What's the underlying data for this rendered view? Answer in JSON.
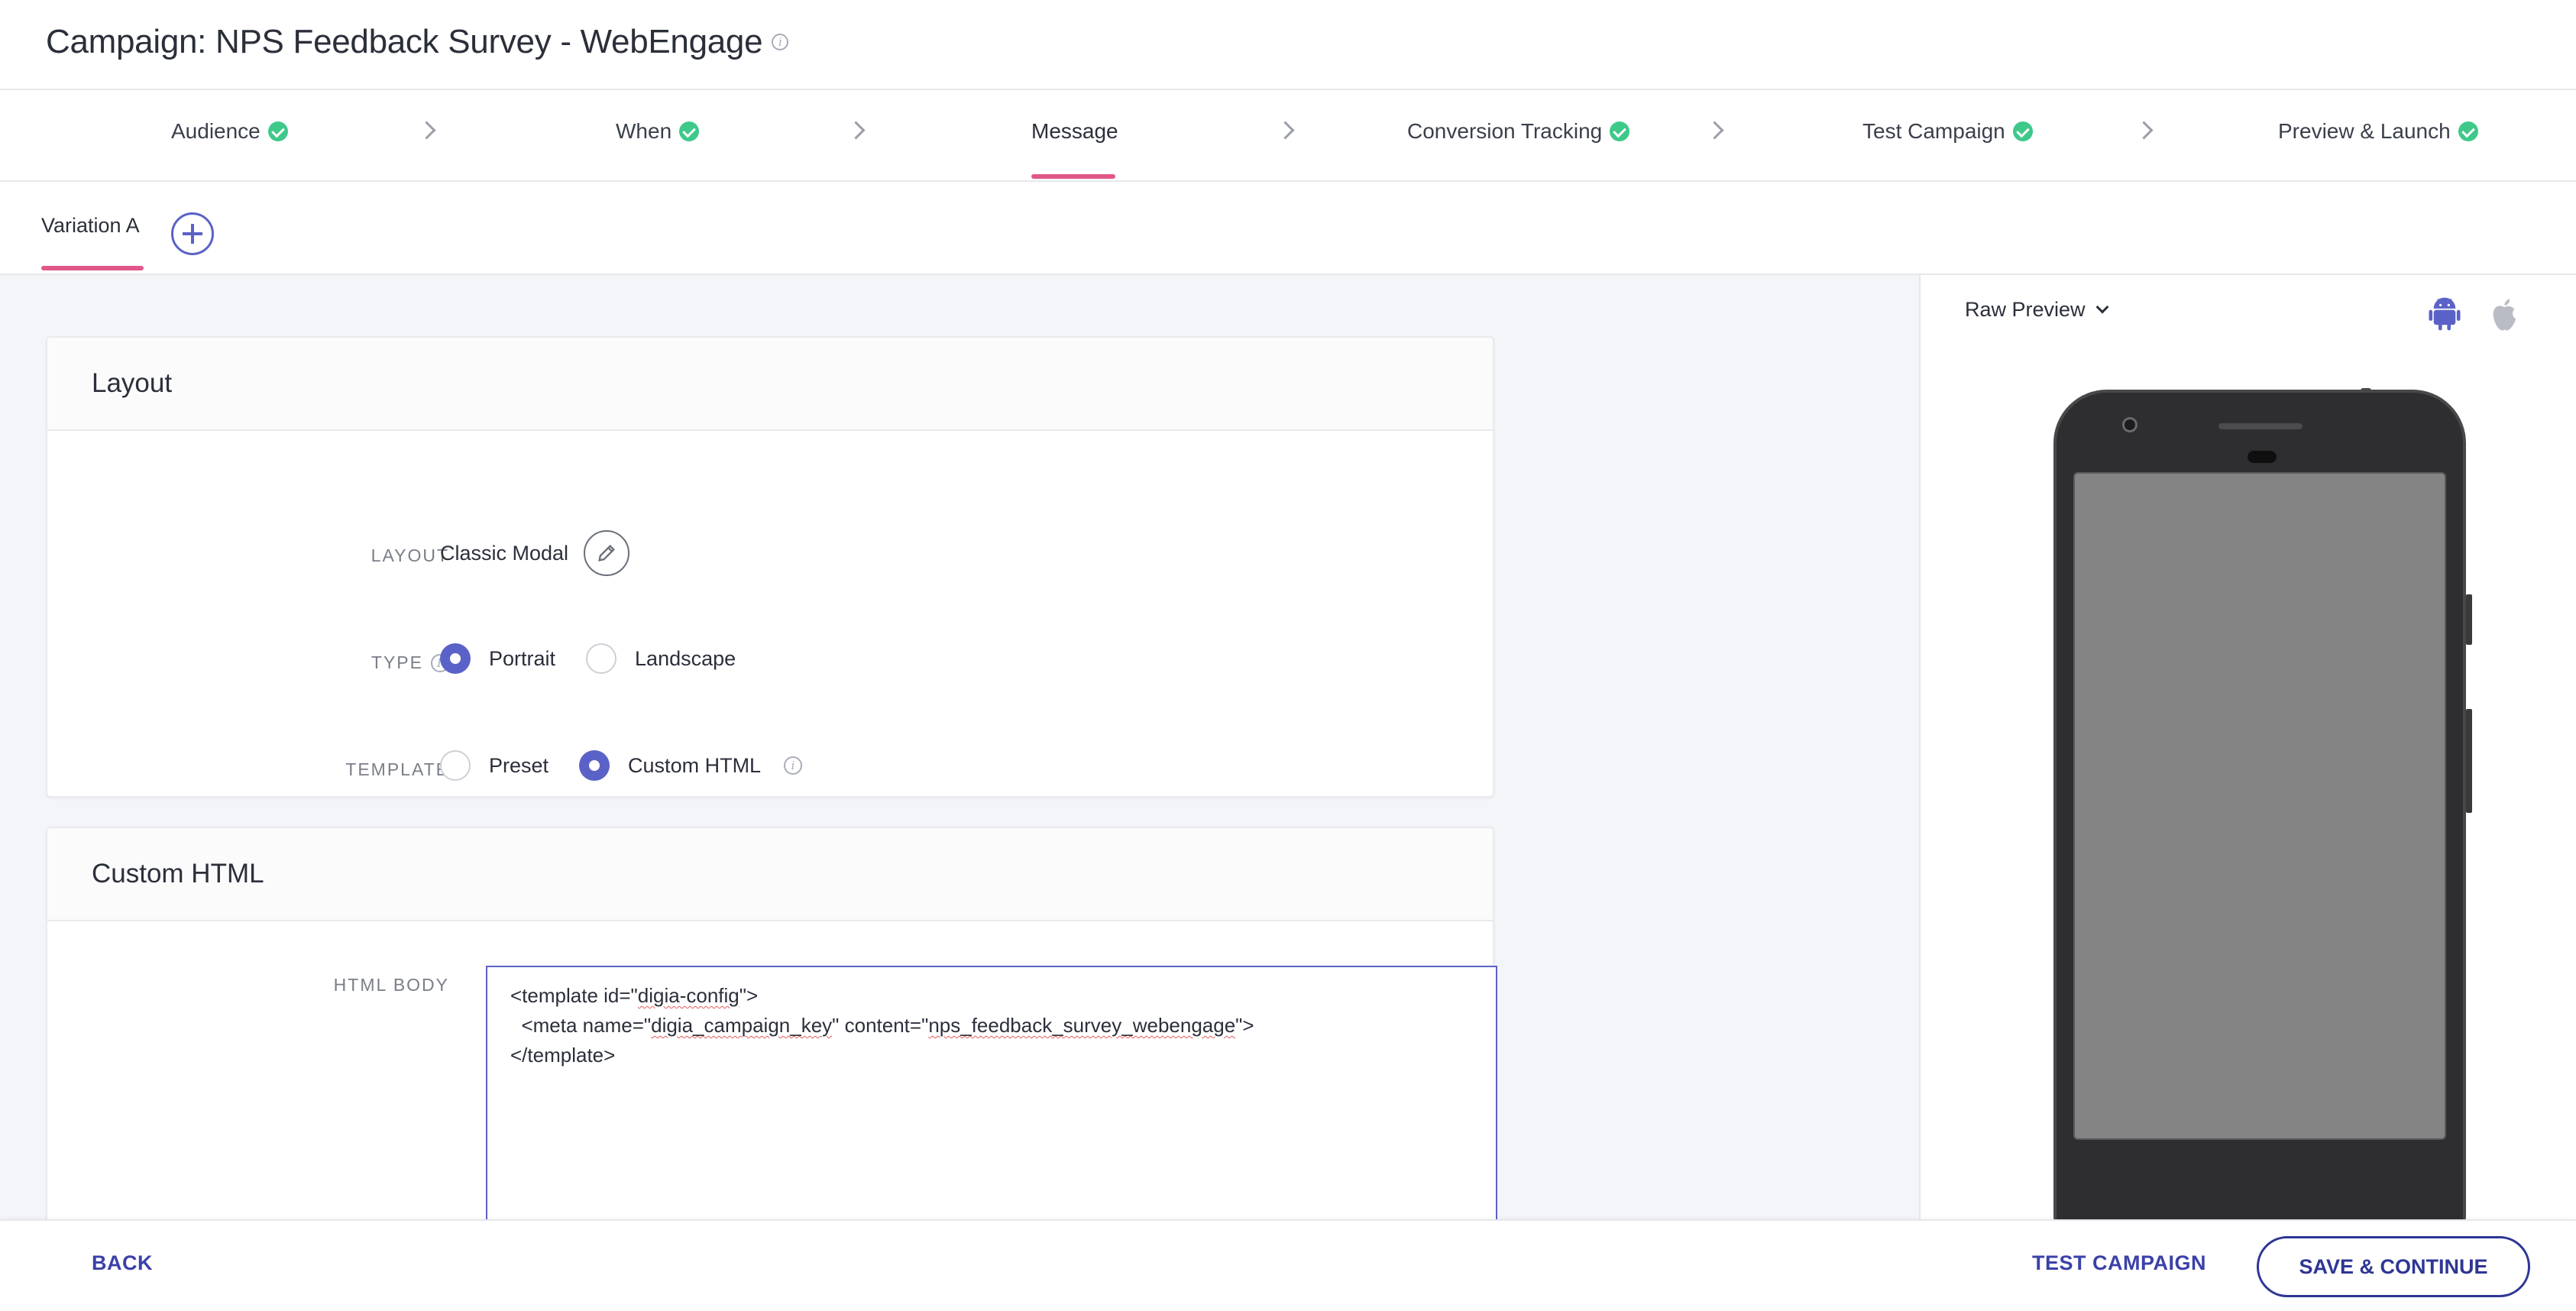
{
  "header": {
    "title": "Campaign: NPS Feedback Survey - WebEngage"
  },
  "steps": [
    {
      "label": "Audience",
      "done": true
    },
    {
      "label": "When",
      "done": true
    },
    {
      "label": "Message",
      "done": false,
      "active": true
    },
    {
      "label": "Conversion Tracking",
      "done": true
    },
    {
      "label": "Test Campaign",
      "done": true
    },
    {
      "label": "Preview & Launch",
      "done": true
    }
  ],
  "variations": {
    "active_tab": "Variation A"
  },
  "layout_card": {
    "title": "Layout",
    "layout_label": "LAYOUT",
    "layout_value": "Classic Modal",
    "type_label": "TYPE",
    "type_options": [
      "Portrait",
      "Landscape"
    ],
    "type_selected": "Portrait",
    "template_label": "TEMPLATE",
    "template_options": [
      "Preset",
      "Custom HTML"
    ],
    "template_selected": "Custom HTML"
  },
  "custom_html_card": {
    "title": "Custom HTML",
    "body_label": "HTML BODY",
    "code_lines": [
      "<template id=\"digia-config\">",
      "  <meta name=\"digia_campaign_key\" content=\"nps_feedback_survey_webengage\">",
      "</template>"
    ]
  },
  "preview": {
    "mode": "Raw Preview",
    "platforms": [
      "android-icon",
      "apple-icon"
    ],
    "active_platform": "android",
    "android_color": "#5b62c7",
    "apple_color": "#b9bcc4"
  },
  "footer": {
    "back_label": "BACK",
    "test_label": "TEST CAMPAIGN",
    "save_label": "SAVE & CONTINUE"
  },
  "colors": {
    "accent": "#5b62c7",
    "underline": "#e2578a",
    "success": "#3ec98a",
    "primary_dark": "#2e3694"
  }
}
